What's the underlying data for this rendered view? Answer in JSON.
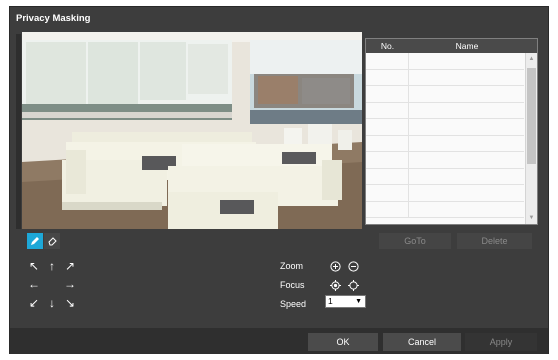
{
  "dialog": {
    "title": "Privacy Masking"
  },
  "mask_list": {
    "columns": {
      "no": "No.",
      "name": "Name"
    },
    "rows": 10
  },
  "actions": {
    "goto": "GoTo",
    "delete": "Delete"
  },
  "ptz": {
    "zoom_label": "Zoom",
    "focus_label": "Focus",
    "speed_label": "Speed",
    "speed_value": "1"
  },
  "footer": {
    "ok": "OK",
    "cancel": "Cancel",
    "apply": "Apply"
  },
  "colors": {
    "accent": "#1ea8d8",
    "panel": "#3d3d3d",
    "footer": "#2f2f2f"
  },
  "icons": {
    "draw_tool": "pencil-icon",
    "erase_tool": "eraser-icon",
    "zoom_in": "zoom-in-icon",
    "zoom_out": "zoom-out-icon",
    "focus_near": "focus-near-icon",
    "focus_far": "focus-far-icon"
  }
}
